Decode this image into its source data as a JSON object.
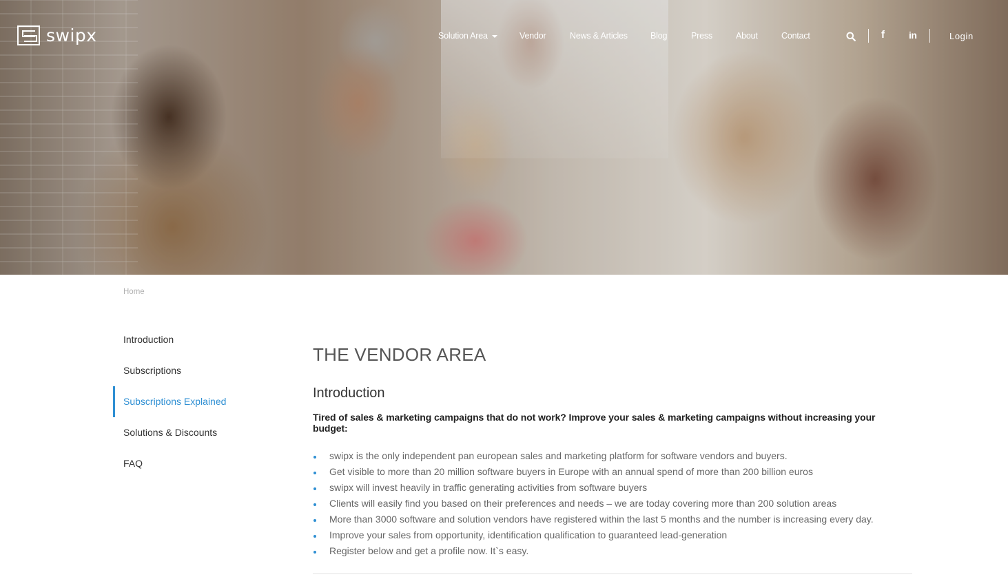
{
  "brand": {
    "name": "swipx"
  },
  "nav": {
    "items": [
      {
        "label": "Solution Area",
        "has_dropdown": true
      },
      {
        "label": "Vendor"
      },
      {
        "label": "News & Articles"
      },
      {
        "label": "Blog"
      },
      {
        "label": "Press"
      },
      {
        "label": "About"
      },
      {
        "label": "Contact"
      }
    ],
    "search_icon": "search-icon",
    "facebook_glyph": "f",
    "linkedin_glyph": "in",
    "login_label": "Login"
  },
  "breadcrumb": {
    "home": "Home"
  },
  "sidebar": {
    "items": [
      {
        "label": "Introduction",
        "active": false
      },
      {
        "label": "Subscriptions",
        "active": false
      },
      {
        "label": "Subscriptions Explained",
        "active": true
      },
      {
        "label": "Solutions & Discounts",
        "active": false
      },
      {
        "label": "FAQ",
        "active": false
      }
    ]
  },
  "main": {
    "title": "THE VENDOR AREA",
    "section_title": "Introduction",
    "lead": "Tired of sales & marketing campaigns that do not work? Improve your sales & marketing campaigns without increasing your budget:",
    "bullets": [
      "swipx is the only independent pan european sales and marketing platform for software vendors and buyers.",
      "Get visible to more than 20 million software buyers in Europe with an annual spend of more than 200 billion euros",
      "swipx will invest heavily in traffic generating activities from software buyers",
      "Clients will easily find you based on their preferences and needs – we are today covering more than 200 solution areas",
      "More than 3000 software and solution vendors have registered within the last 5 months and the number is increasing every day.",
      "Improve your sales from opportunity, identification qualification to guaranteed lead-generation",
      "Register below and get a profile now. It`s easy."
    ]
  },
  "colors": {
    "accent": "#2e8fd3",
    "text": "#333333",
    "muted": "#666666"
  }
}
